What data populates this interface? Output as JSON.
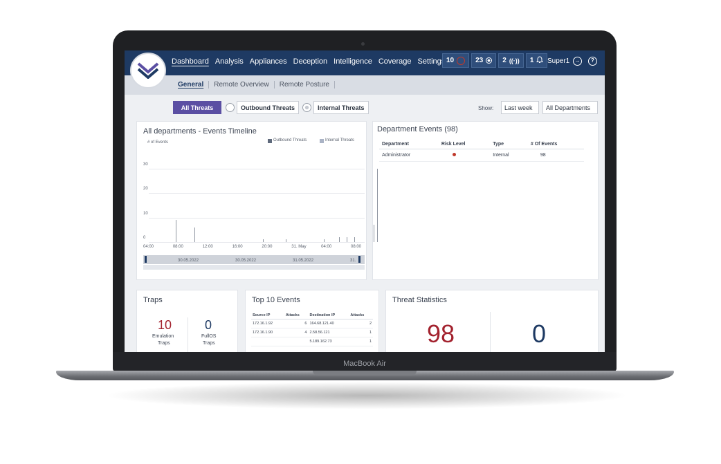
{
  "device": {
    "brand": "MacBook Air"
  },
  "nav": {
    "items": [
      "Dashboard",
      "Analysis",
      "Appliances",
      "Deception",
      "Intelligence",
      "Coverage",
      "Settings"
    ],
    "active": "Dashboard"
  },
  "counters": [
    {
      "value": "10",
      "icon": "alert-ring-icon"
    },
    {
      "value": "23",
      "icon": "target-icon"
    },
    {
      "value": "2",
      "icon": "broadcast-icon"
    },
    {
      "value": "1",
      "icon": "bell-icon"
    }
  ],
  "user": {
    "name": "Super1"
  },
  "subtabs": {
    "items": [
      "General",
      "Remote Overview",
      "Remote Posture"
    ],
    "active": "General"
  },
  "filters": {
    "all": "All Threats",
    "outbound": "Outbound Threats",
    "internal": "Internal Threats",
    "show_label": "Show:",
    "period": "Last week",
    "department": "All Departments"
  },
  "timeline": {
    "title": "All departments - Events Timeline",
    "ylabel": "# of Events",
    "legend": [
      "Outbound Threats",
      "Internal Threats"
    ],
    "range_dates": [
      "30.05.2022",
      "30.05.2022",
      "31.05.2022",
      "31."
    ]
  },
  "chart_data": {
    "type": "bar",
    "title": "All departments - Events Timeline",
    "ylabel": "# of Events",
    "ylim": [
      0,
      30
    ],
    "yticks": [
      "0",
      "10",
      "20",
      "30"
    ],
    "xticks": [
      "04:00",
      "08:00",
      "12:00",
      "16:00",
      "20:00",
      "31. May",
      "04:00",
      "08:00"
    ],
    "series": [
      {
        "name": "Outbound Threats",
        "values": []
      },
      {
        "name": "Internal Threats",
        "values": []
      }
    ],
    "bars": [
      {
        "x": "07:30",
        "y": 9
      },
      {
        "x": "10:00",
        "y": 6
      },
      {
        "x": "19:00",
        "y": 1
      },
      {
        "x": "22:00",
        "y": 1
      },
      {
        "x": "03:00",
        "y": 1
      },
      {
        "x": "05:00",
        "y": 2
      },
      {
        "x": "06:00",
        "y": 2
      },
      {
        "x": "07:00",
        "y": 2
      },
      {
        "x": "09:30",
        "y": 7
      },
      {
        "x": "10:00",
        "y": 30
      }
    ],
    "grid": true,
    "legend_position": "top-right"
  },
  "department_events": {
    "title": "Department Events (98)",
    "columns": [
      "Department",
      "Risk Level",
      "Type",
      "# Of Events"
    ],
    "rows": [
      {
        "department": "Administrator",
        "type": "Internal",
        "events": "98"
      }
    ]
  },
  "traps": {
    "title": "Traps",
    "emulation": {
      "value": "10",
      "label1": "Emulation",
      "label2": "Traps"
    },
    "fullos": {
      "value": "0",
      "label1": "FullOS",
      "label2": "Traps"
    }
  },
  "top10": {
    "title": "Top 10 Events",
    "columns": [
      "Source IP",
      "Attacks",
      "Destination IP",
      "Attacks"
    ],
    "source": [
      {
        "ip": "172.16.1.92",
        "n": "6"
      },
      {
        "ip": "172.16.1.90",
        "n": "4"
      }
    ],
    "dest": [
      {
        "ip": "164.68.121.40",
        "n": "2"
      },
      {
        "ip": "2.58.56.121",
        "n": "1"
      },
      {
        "ip": "5.189.162.73",
        "n": "1"
      }
    ]
  },
  "threat_stats": {
    "title": "Threat Statistics",
    "value1": "98",
    "value2": "0"
  },
  "colors": {
    "navbar": "#1e3a63",
    "accent": "#5b4fa3",
    "red": "#a3222e",
    "navy": "#1e3a63"
  }
}
